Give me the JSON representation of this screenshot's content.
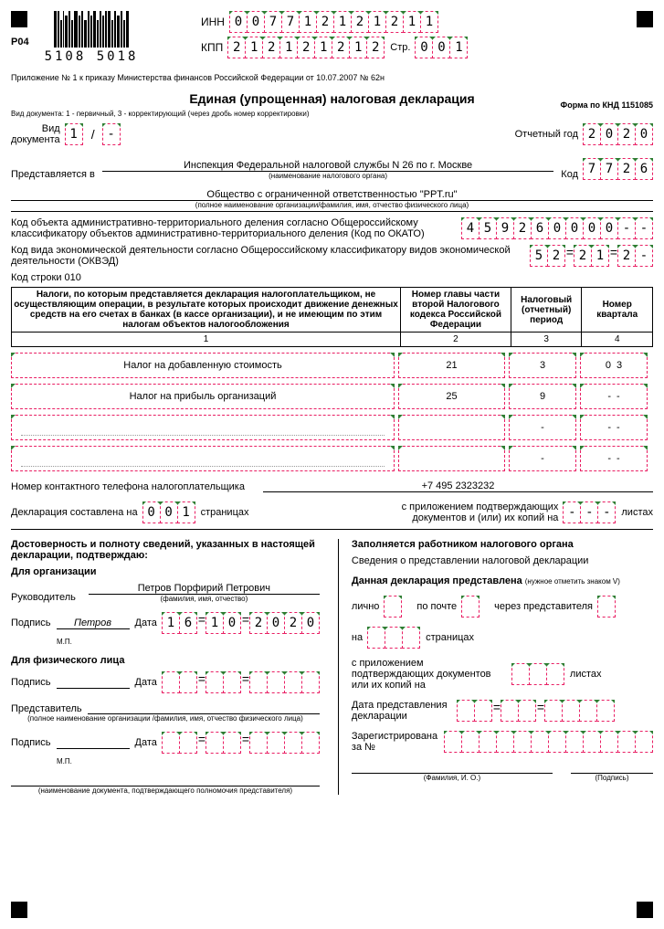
{
  "corners": true,
  "p04": "Р04",
  "barcode_number": "5108 5018",
  "inn_label": "ИНН",
  "inn": [
    "0",
    "0",
    "7",
    "7",
    "1",
    "2",
    "1",
    "2",
    "1",
    "2",
    "1",
    "1"
  ],
  "kpp_label": "КПП",
  "kpp": [
    "2",
    "1",
    "2",
    "1",
    "2",
    "1",
    "2",
    "1",
    "2"
  ],
  "page_label": "Стр.",
  "page": [
    "0",
    "0",
    "1"
  ],
  "appendix_note": "Приложение № 1 к приказу Министерства финансов Российской Федерации от 10.07.2007 № 62н",
  "title": "Единая (упрощенная) налоговая декларация",
  "form_code": "Форма по КНД 1151085",
  "vid_note": "Вид документа: 1 - первичный, 3 - корректирующий (через дробь номер корректировки)",
  "vid_label": "Вид\nдокумента",
  "vid": [
    "1"
  ],
  "vid_after": "-",
  "year_label": "Отчетный год",
  "year": [
    "2",
    "0",
    "2",
    "0"
  ],
  "present_label": "Представляется в",
  "authority": "Инспекция Федеральной налоговой службы N 26 по г. Москве",
  "authority_sub": "(наименование налогового органа)",
  "kod_label": "Код",
  "kod": [
    "7",
    "7",
    "2",
    "6"
  ],
  "org_name": "Общество с ограниченной ответственностью \"PPT.ru\"",
  "org_sub": "(полное наименование организации/фамилия, имя, отчество физического лица)",
  "okato_text": "Код объекта административно-территориального деления согласно Общероссийскому классификатору объектов административно-территориального деления (Код по ОКАТО)",
  "okato": [
    "4",
    "5",
    "9",
    "2",
    "6",
    "0",
    "0",
    "0",
    "0",
    "-",
    "-"
  ],
  "okved_text": "Код вида экономической деятельности согласно Общероссийскому классификатору видов экономической деятельности (ОКВЭД)",
  "okved": [
    "5",
    "2",
    "=",
    "2",
    "1",
    "=",
    "2",
    "-"
  ],
  "row_code": "Код строки 010",
  "table": {
    "h1": "Налоги, по которым представляется декларация налогоплательщиком, не осуществляющим операции, в результате которых происходит движение денежных средств на его счетах в банках (в кассе организации), и не имеющим по этим налогам объектов налогообложения",
    "h2": "Номер главы части второй Налогового кодекса Российской Федерации",
    "h3": "Налоговый (отчетный) период",
    "h4": "Номер квартала",
    "n1": "1",
    "n2": "2",
    "n3": "3",
    "n4": "4",
    "rows": [
      {
        "name": "Налог на добавленную стоимость",
        "ch": "21",
        "per": "3",
        "q": "03"
      },
      {
        "name": "Налог на прибыль организаций",
        "ch": "25",
        "per": "9",
        "q": "- -"
      },
      {
        "name": "",
        "ch": "",
        "per": "-",
        "q": "- -"
      },
      {
        "name": "",
        "ch": "",
        "per": "-",
        "q": "- -"
      }
    ]
  },
  "phone_label": "Номер контактного телефона налогоплательщика",
  "phone": "+7 495 2323232",
  "decl_pages_label_1": "Декларация составлена на",
  "decl_pages": [
    "0",
    "0",
    "1"
  ],
  "decl_pages_label_2": "страницах",
  "attach_label": "с приложением подтверждающих документов и (или) их копий на",
  "attach": [
    "-",
    "-",
    "-"
  ],
  "attach_unit": "листах",
  "left": {
    "header": "Достоверность и полноту сведений, указанных в настоящей декларации, подтверждаю:",
    "for_org": "Для организации",
    "ruk_label": "Руководитель",
    "ruk_name": "Петров Порфирий Петрович",
    "ruk_sub": "(фамилия, имя, отчество)",
    "sign_label": "Подпись",
    "sign_val": "Петров",
    "mp": "М.П.",
    "date_label": "Дата",
    "date": [
      "1",
      "6",
      "=",
      "1",
      "0",
      "=",
      "2",
      "0",
      "2",
      "0"
    ],
    "for_fiz": "Для физического лица",
    "date2": [
      "",
      "",
      "=",
      "",
      "",
      "=",
      "",
      "",
      "",
      ""
    ],
    "pred_label": "Представитель",
    "pred_sub": "(полное наименование организации /фамилия, имя, отчество физического лица)",
    "doc_sub": "(наименование документа, подтверждающего полномочия представителя)"
  },
  "right_block": {
    "header": "Заполняется работником налогового органа",
    "info": "Сведения о представлении налоговой декларации",
    "presented": "Данная декларация представлена",
    "presented_note": "(нужное отметить знаком V)",
    "lichno": "лично",
    "post": "по почте",
    "pred": "через представителя",
    "na": "на",
    "pages_unit": "страницах",
    "attach2": "с приложением подтверждающих документов или их копий на",
    "attach2_unit": "листах",
    "date_pred": "Дата представления декларации",
    "reg_label": "Зарегистрирована за №",
    "fio_sub": "(Фамилия, И. О.)",
    "sign_sub": "(Подпись)"
  }
}
